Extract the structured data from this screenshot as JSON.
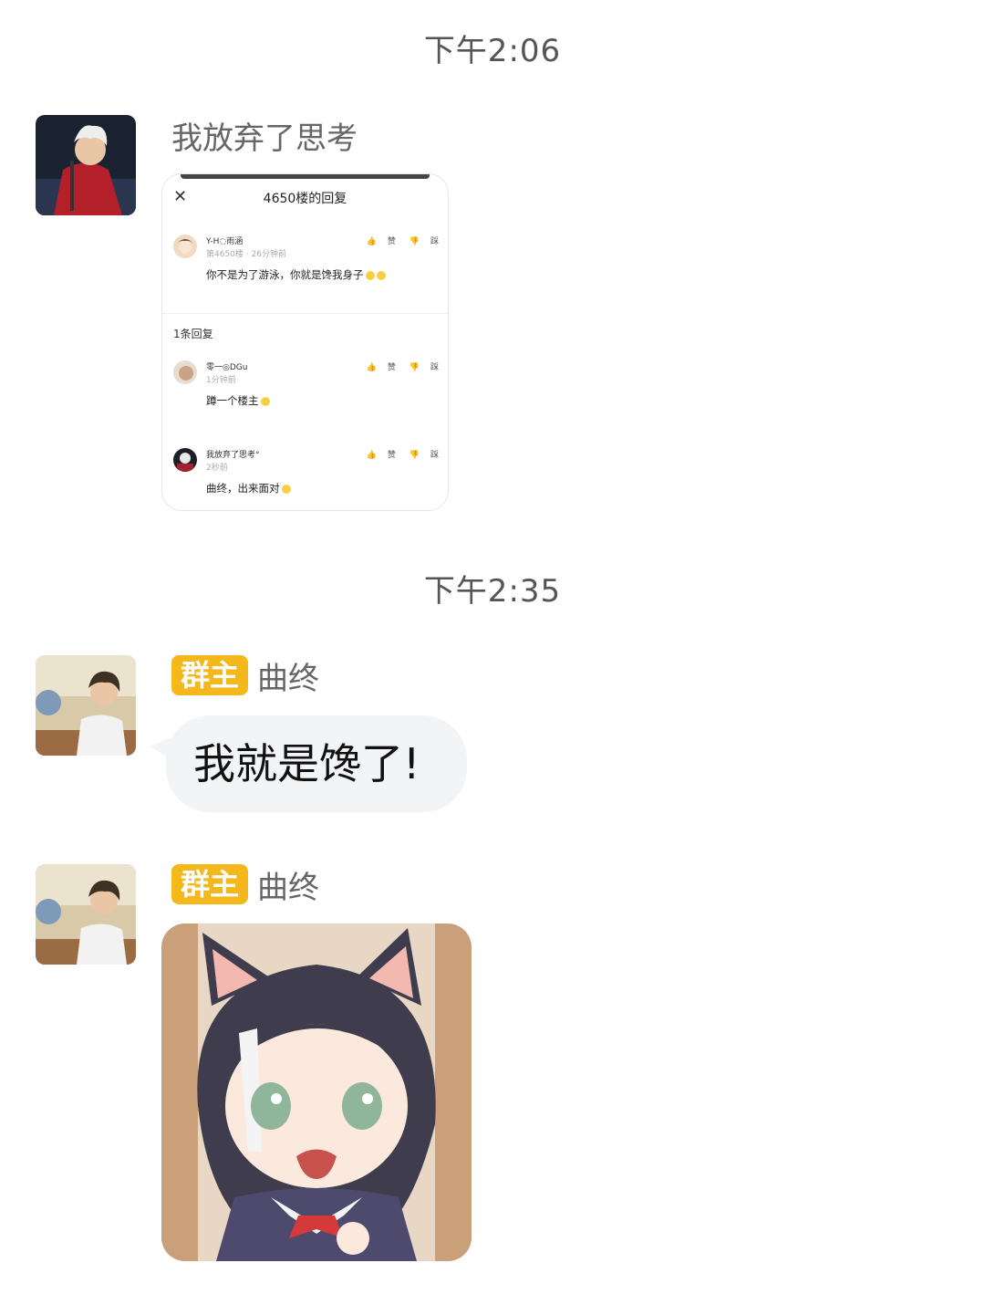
{
  "messages": [
    {
      "type": "timestamp",
      "text": "下午2:06"
    },
    {
      "type": "message",
      "sender": {
        "name": "我放弃了思考"
      },
      "content": {
        "kind": "screenshot",
        "title": "4650楼的回复",
        "post": {
          "user": "Y-H◌雨涵",
          "meta": "第4650楼 · 26分钟前",
          "text": "你不是为了游泳，你就是馋我身子"
        },
        "reply_count": "1条回复",
        "replies": [
          {
            "user": "零一◎DGu",
            "meta": "1分钟前",
            "text": "蹲一个楼主"
          },
          {
            "user": "我放弃了思考°",
            "meta": "2秒前",
            "text": "曲终，出来面对"
          }
        ],
        "actions": {
          "like": "赞",
          "dislike": "踩"
        }
      }
    },
    {
      "type": "timestamp",
      "text": "下午2:35"
    },
    {
      "type": "message",
      "sender": {
        "badge": "群主",
        "name": "曲终"
      },
      "content": {
        "kind": "text",
        "text": "我就是馋了!"
      }
    },
    {
      "type": "message",
      "sender": {
        "badge": "群主",
        "name": "曲终"
      },
      "content": {
        "kind": "sticker",
        "subject": "cat-ear-anime-girl-sticker"
      }
    }
  ],
  "colors": {
    "owner_badge": "#f5b81c",
    "bubble": "#f3f4f6"
  }
}
